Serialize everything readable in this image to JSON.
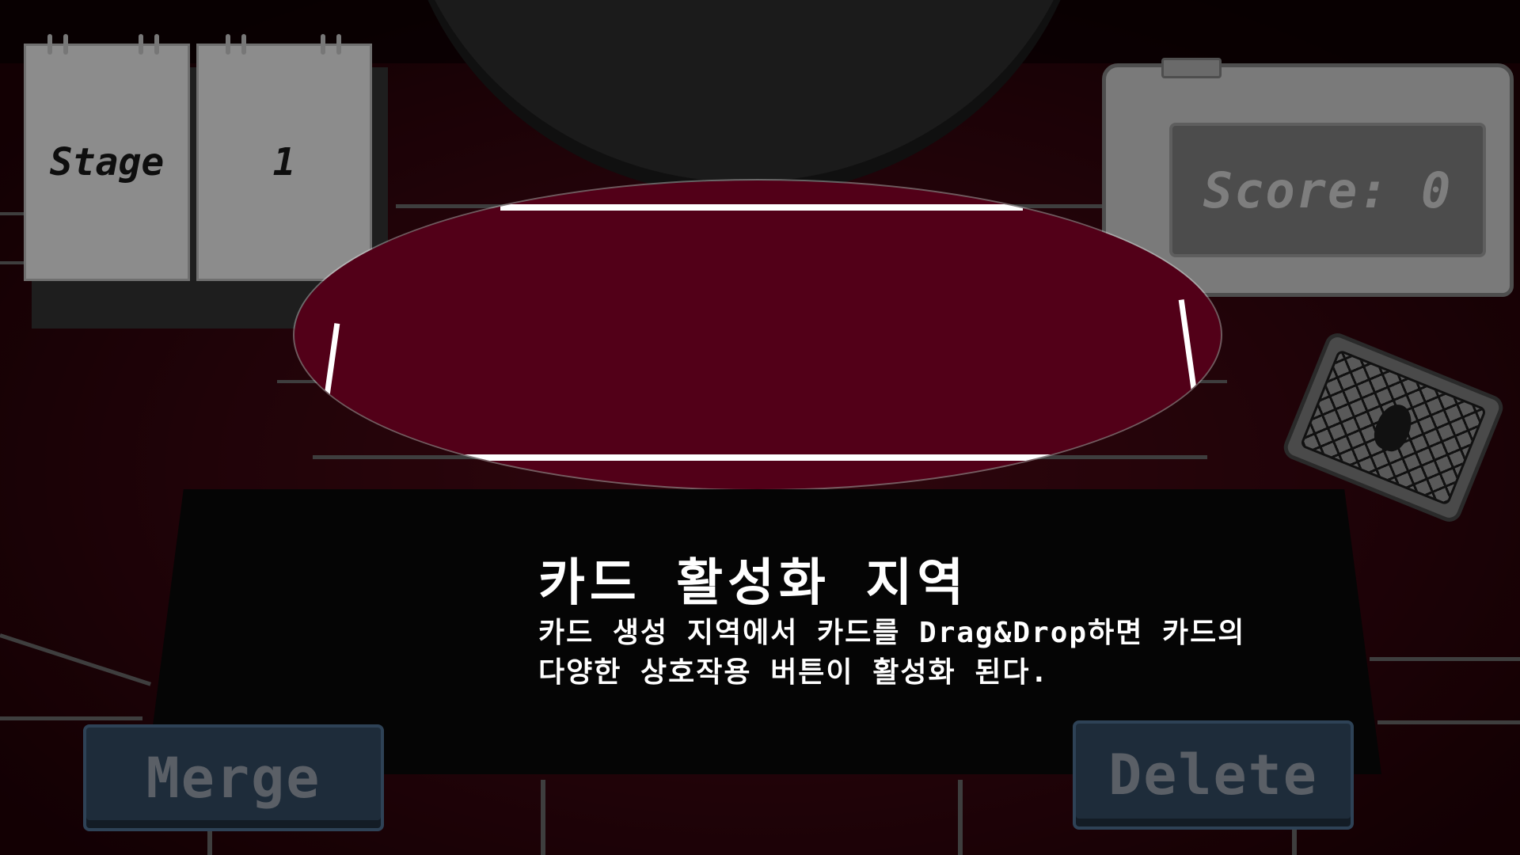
{
  "stage": {
    "label": "Stage",
    "value": "1"
  },
  "score": {
    "text": "Score: 0"
  },
  "tooltip": {
    "title": "카드 활성화 지역",
    "line1": "카드 생성 지역에서 카드를 Drag&Drop하면 카드의",
    "line2": "다양한 상호작용 버튼이 활성화 된다."
  },
  "buttons": {
    "merge": "Merge",
    "delete": "Delete"
  },
  "icons": {
    "deck": "card-deck-icon"
  },
  "colors": {
    "felt": "#5a0a18",
    "highlight": "#520018",
    "button": "#1e2c3a"
  }
}
